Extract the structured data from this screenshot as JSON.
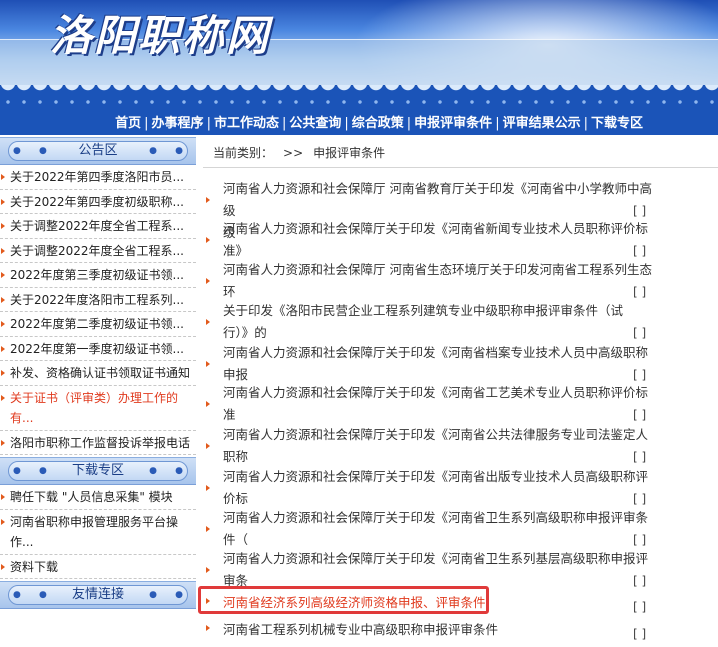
{
  "site": {
    "logo_text": "洛阳职称网"
  },
  "nav": {
    "items": [
      "首页",
      "办事程序",
      "市工作动态",
      "公共查询",
      "综合政策",
      "申报评审条件",
      "评审结果公示",
      "下载专区"
    ],
    "separator": "|"
  },
  "sidebar": {
    "announcements_title": "公告区",
    "announcements": [
      "关于2022年第四季度洛阳市员...",
      "关于2022年第四季度初级职称...",
      "关于调整2022年度全省工程系...",
      "关于调整2022年度全省工程系...",
      "2022年度第三季度初级证书领...",
      "关于2022年度洛阳市工程系列...",
      "2022年度第二季度初级证书领...",
      "2022年度第一季度初级证书领...",
      "补发、资格确认证书领取证书通知",
      "关于证书（评审类）办理工作的有...",
      "洛阳市职称工作监督投诉举报电话"
    ],
    "downloads_title": "下载专区",
    "downloads": [
      "聘任下载 \"人员信息采集\" 模块",
      "河南省职称申报管理服务平台操作...",
      "资料下载"
    ],
    "links_title": "友情连接"
  },
  "breadcrumb": {
    "label": "当前类别：",
    "arrow": ">>",
    "current": "申报评审条件"
  },
  "articles": [
    {
      "title": "河南省人力资源和社会保障厅 河南省教育厅关于印发《河南省中小学教师中高级",
      "title2": "级",
      "bracket": "[ ]"
    },
    {
      "title": "河南省人力资源和社会保障厅关于印发《河南省新闻专业技术人员职称评价标",
      "title2": "准》",
      "bracket": "[ ]"
    },
    {
      "title": "河南省人力资源和社会保障厅 河南省生态环境厅关于印发河南省工程系列生态",
      "title2": "环",
      "bracket": "[ ]"
    },
    {
      "title": "关于印发《洛阳市民营企业工程系列建筑专业中级职称申报评审条件（试",
      "title2": "行）》的",
      "bracket": "[ ]"
    },
    {
      "title": "河南省人力资源和社会保障厅关于印发《河南省档案专业技术人员中高级职称",
      "title2": "申报",
      "bracket": "[ ]"
    },
    {
      "title": "河南省人力资源和社会保障厅关于印发《河南省工艺美术专业人员职称评价标",
      "title2": "准",
      "bracket": "[ ]"
    },
    {
      "title": "河南省人力资源和社会保障厅关于印发《河南省公共法律服务专业司法鉴定人",
      "title2": "职称",
      "bracket": "[ ]"
    },
    {
      "title": "河南省人力资源和社会保障厅关于印发《河南省出版专业技术人员高级职称评",
      "title2": "价标",
      "bracket": "[ ]"
    },
    {
      "title": "河南省人力资源和社会保障厅关于印发《河南省卫生系列高级职称申报评审条",
      "title2": "件（",
      "bracket": "[ ]"
    },
    {
      "title": "河南省人力资源和社会保障厅关于印发《河南省卫生系列基层高级职称申报评",
      "title2": "审条",
      "bracket": "[ ]"
    },
    {
      "title": "河南省经济系列高级经济师资格申报、评审条件",
      "title2": "",
      "bracket": "[ ]"
    },
    {
      "title": "河南省工程系列机械专业中高级职称申报评审条件",
      "title2": "",
      "bracket": "[ ]"
    }
  ]
}
